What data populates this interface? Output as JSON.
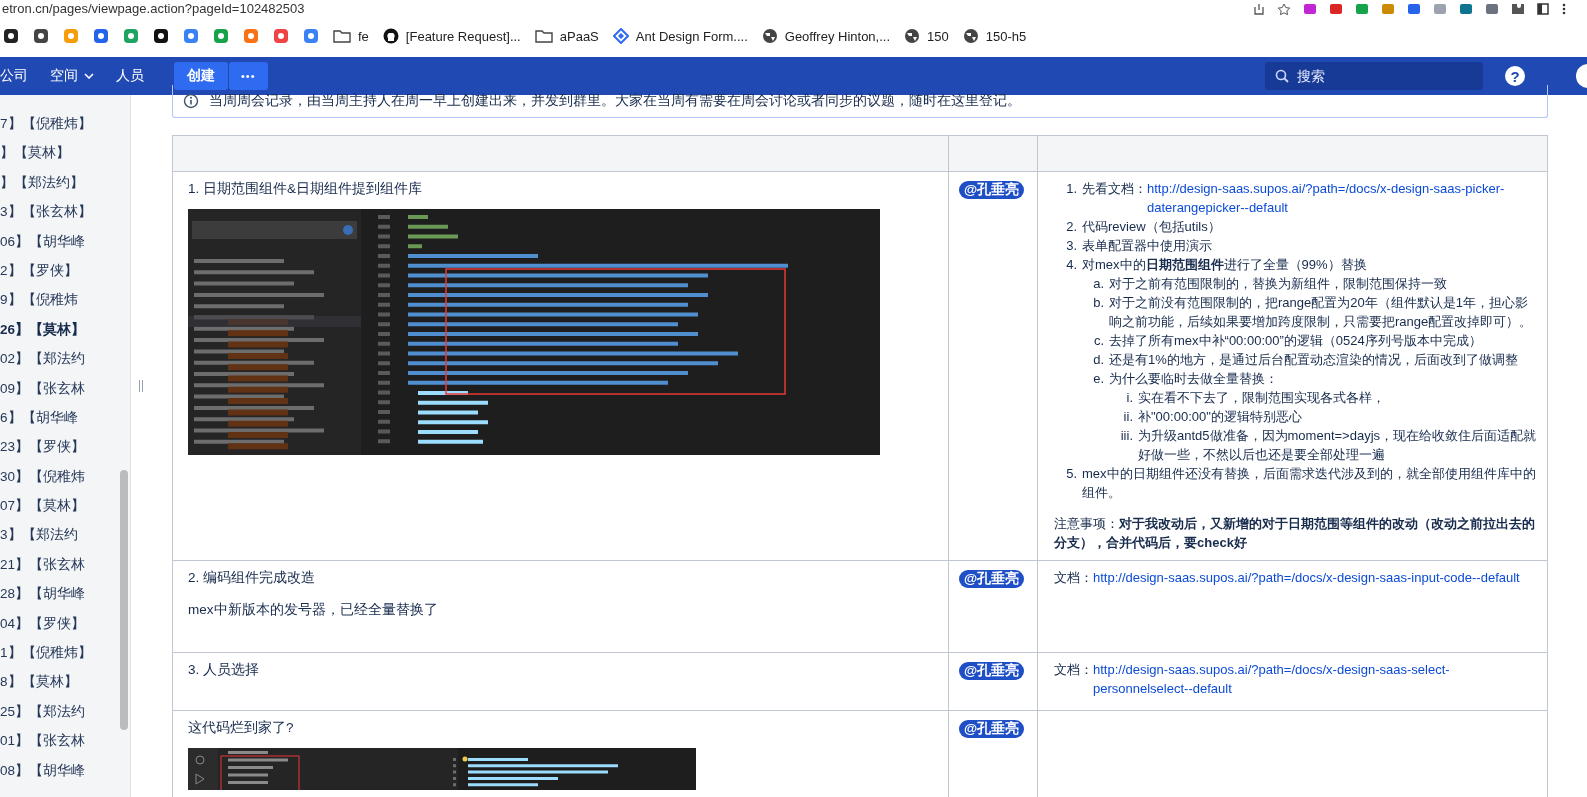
{
  "address_bar": {
    "url": "etron.cn/pages/viewpage.action?pageId=102482503"
  },
  "bookmarks": [
    {
      "kind": "site",
      "color": "#222222"
    },
    {
      "kind": "site",
      "color": "#444444"
    },
    {
      "kind": "site",
      "color": "#f59e0b"
    },
    {
      "kind": "site",
      "color": "#2563eb"
    },
    {
      "kind": "site",
      "color": "#1ea362"
    },
    {
      "kind": "site",
      "color": "#111111"
    },
    {
      "kind": "site",
      "color": "#3b82f6"
    },
    {
      "kind": "site",
      "color": "#16a34a"
    },
    {
      "kind": "site",
      "color": "#f97316"
    },
    {
      "kind": "site",
      "color": "#ef4444"
    },
    {
      "kind": "site",
      "color": "#3b82f6"
    },
    {
      "kind": "folder",
      "label": "fe"
    },
    {
      "kind": "github",
      "label": "[Feature Request]..."
    },
    {
      "kind": "folder",
      "label": "aPaaS"
    },
    {
      "kind": "ant",
      "label": "Ant Design Form...."
    },
    {
      "kind": "globe",
      "label": "Geoffrey Hinton,..."
    },
    {
      "kind": "globe",
      "label": "150"
    },
    {
      "kind": "globe",
      "label": "150-h5"
    }
  ],
  "nav": {
    "items": [
      {
        "label": "公司",
        "dropdown": false
      },
      {
        "label": "空间",
        "dropdown": true
      },
      {
        "label": "人员",
        "dropdown": false
      }
    ],
    "create": "创建",
    "more": "•••",
    "search": {
      "placeholder": "搜索"
    },
    "help": "?"
  },
  "sidebar": {
    "items": [
      {
        "label": "7】【倪稚炜】",
        "selected": false
      },
      {
        "label": "】【莫林】",
        "selected": false
      },
      {
        "label": "】【郑法约】",
        "selected": false
      },
      {
        "label": "3】【张玄林】",
        "selected": false
      },
      {
        "label": "06】【胡华峰",
        "selected": false
      },
      {
        "label": "2】【罗侠】",
        "selected": false
      },
      {
        "label": "9】【倪稚炜",
        "selected": false
      },
      {
        "label": "26】【莫林】",
        "selected": true
      },
      {
        "label": "02】【郑法约",
        "selected": false
      },
      {
        "label": "09】【张玄林",
        "selected": false
      },
      {
        "label": "6】【胡华峰",
        "selected": false
      },
      {
        "label": "23】【罗侠】",
        "selected": false
      },
      {
        "label": "30】【倪稚炜",
        "selected": false
      },
      {
        "label": "07】【莫林】",
        "selected": false
      },
      {
        "label": "3】【郑法约",
        "selected": false
      },
      {
        "label": "21】【张玄林",
        "selected": false
      },
      {
        "label": "28】【胡华峰",
        "selected": false
      },
      {
        "label": "04】【罗侠】",
        "selected": false
      },
      {
        "label": "1】【倪稚炜】",
        "selected": false
      },
      {
        "label": "8】【莫林】",
        "selected": false
      },
      {
        "label": "25】【郑法约",
        "selected": false
      },
      {
        "label": "01】【张玄林",
        "selected": false
      },
      {
        "label": "08】【胡华峰",
        "selected": false
      }
    ]
  },
  "info_panel": {
    "text": "当周周会记录，由当周主持人在周一早上创建出来，并发到群里。大家在当周有需要在周会讨论或者同步的议题，随时在这里登记。"
  },
  "table": {
    "rows": [
      {
        "topic": "1. 日期范围组件&日期组件提到组件库",
        "attachment": {
          "kind": "picture"
        },
        "owner": "@孔垂亮",
        "notes": [
          {
            "kind": "list",
            "items": [
              {
                "marker": "1.",
                "text": "先看文档：",
                "link": "http://design-saas.supos.ai/?path=/docs/x-design-saas-picker-daterangepicker--default"
              },
              {
                "marker": "2.",
                "text": "代码review（包括utils）"
              },
              {
                "marker": "3.",
                "text": "表单配置器中使用演示"
              },
              {
                "marker": "4.",
                "text": "对mex中的**日期范围组件**进行了全量（99%）替换",
                "children": [
                  {
                    "marker": "a.",
                    "text": "对于之前有范围限制的，替换为新组件，限制范围保持一致"
                  },
                  {
                    "marker": "b.",
                    "text": "对于之前没有范围限制的，把range配置为20年（组件默认是1年，担心影响之前功能，后续如果要增加跨度限制，只需要把range配置改掉即可）。"
                  },
                  {
                    "marker": "c.",
                    "text": "去掉了所有mex中补“00:00:00”的逻辑（0524序列号版本中完成）"
                  },
                  {
                    "marker": "d.",
                    "text": "还是有1%的地方，是通过后台配置动态渲染的情况，后面改到了做调整"
                  },
                  {
                    "marker": "e.",
                    "text": "为什么要临时去做全量替换：",
                    "children": [
                      {
                        "marker": "i.",
                        "text": "实在看不下去了，限制范围实现各式各样，"
                      },
                      {
                        "marker": "ii.",
                        "text": "补\"00:00:00\"的逻辑特别恶心"
                      },
                      {
                        "marker": "iii.",
                        "text": "为升级antd5做准备，因为moment=>dayjs，现在给收敛住后面适配就好做一些，不然以后也还是要全部处理一遍"
                      }
                    ]
                  }
                ]
              },
              {
                "marker": "5.",
                "text": "mex中的日期组件还没有替换，后面需求迭代涉及到的，就全部使用组件库中的组件。"
              }
            ]
          },
          {
            "kind": "remark",
            "text": "注意事项：**对于我改动后，又新增的对于日期范围等组件的改动（改动之前拉出去的分支），合并代码后，要check好**"
          }
        ]
      },
      {
        "topic": "2. 编码组件完成改造",
        "detail": "mex中新版本的发号器，已经全量替换了",
        "owner": "@孔垂亮",
        "notes": [
          {
            "kind": "doc",
            "text": "文档：",
            "link": "http://design-saas.supos.ai/?path=/docs/x-design-saas-input-code--default"
          }
        ]
      },
      {
        "topic": "3. 人员选择",
        "owner": "@孔垂亮",
        "notes": [
          {
            "kind": "doc",
            "text": "文档：",
            "link": "http://design-saas.supos.ai/?path=/docs/x-design-saas-select-personnelselect--default"
          }
        ]
      },
      {
        "topic": "这代码烂到家了?",
        "attachment": {
          "kind": "picture"
        },
        "owner": "@孔垂亮",
        "notes": []
      }
    ]
  }
}
